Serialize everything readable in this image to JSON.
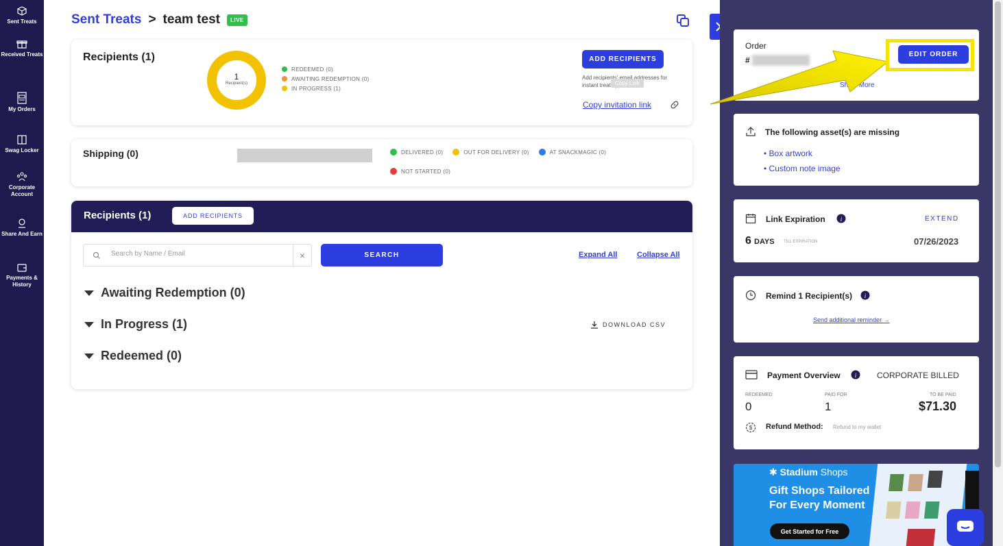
{
  "nav": {
    "items": [
      {
        "label": "Sent Treats"
      },
      {
        "label": "Received Treats"
      },
      {
        "label": "My Orders"
      },
      {
        "label": "Swag Locker"
      },
      {
        "label": "Corporate Account"
      },
      {
        "label": "Share And Earn"
      },
      {
        "label": "Payments & History"
      }
    ]
  },
  "breadcrumb": {
    "root": "Sent Treats",
    "separator": ">",
    "current": "team test",
    "badge": "LIVE"
  },
  "recipients_summary": {
    "title": "Recipients (1)",
    "donut_count": "1",
    "donut_label": "Recipient(s)",
    "legend": [
      {
        "label": "REDEEMED (0)",
        "color": "#2fbf4a"
      },
      {
        "label": "AWAITING REDEMPTION (0)",
        "color": "#f0913a"
      },
      {
        "label": "IN PROGRESS (1)",
        "color": "#f2c200"
      }
    ],
    "add_button": "ADD RECIPIENTS",
    "note": "Add recipients' email addresses for instant treat approval",
    "tooltip": "Copy Link",
    "copy_link": "Copy invitation link"
  },
  "shipping": {
    "title": "Shipping (0)",
    "legend": [
      {
        "label": "DELIVERED (0)",
        "color": "#2fbf4a"
      },
      {
        "label": "OUT FOR DELIVERY (0)",
        "color": "#f2c200"
      },
      {
        "label": "AT SNACKMAGIC (0)",
        "color": "#2f7ae6"
      },
      {
        "label": "NOT STARTED (0)",
        "color": "#e83b3b"
      }
    ]
  },
  "recipients_table": {
    "title": "Recipients (1)",
    "add_button": "ADD RECIPIENTS",
    "search_placeholder": "Search by Name / Email",
    "search_button": "SEARCH",
    "expand_all": "Expand All",
    "collapse_all": "Collapse All",
    "groups": [
      {
        "label": "Awaiting Redemption (0)"
      },
      {
        "label": "In Progress (1)"
      },
      {
        "label": "Redeemed (0)"
      }
    ],
    "download": "DOWNLOAD CSV"
  },
  "order": {
    "label": "Order",
    "hash": "#",
    "edit_button": "EDIT ORDER",
    "show_more": "Show More"
  },
  "missing_assets": {
    "title": "The following asset(s) are missing",
    "items": [
      "Box artwork",
      "Custom note image"
    ]
  },
  "link_expiration": {
    "title": "Link Expiration",
    "extend": "EXTEND",
    "days_value": "6",
    "days_unit": "DAYS",
    "till": "TILL EXPIRATION",
    "date": "07/26/2023"
  },
  "reminder": {
    "title": "Remind 1 Recipient(s)",
    "link": "Send additional reminder →"
  },
  "payment": {
    "title": "Payment Overview",
    "billing": "CORPORATE BILLED",
    "redeemed_label": "REDEEMED",
    "redeemed_value": "0",
    "paid_label": "PAID FOR",
    "paid_value": "1",
    "tobepaid_label": "TO BE PAID",
    "tobepaid_value": "$71.30",
    "refund_label": "Refund Method:",
    "refund_value": "Refund to my wallet"
  },
  "promo": {
    "brand": "Stadium",
    "brand_suffix": "Shops",
    "headline_1": "Gift Shops Tailored",
    "headline_2": "For Every Moment",
    "cta": "Get Started for Free"
  },
  "colors": {
    "nav_bg": "#1f1a4e",
    "primary": "#2d3ee0",
    "panel_bg": "#3a3666",
    "header_bg": "#231d57",
    "highlight": "#f5e400"
  }
}
